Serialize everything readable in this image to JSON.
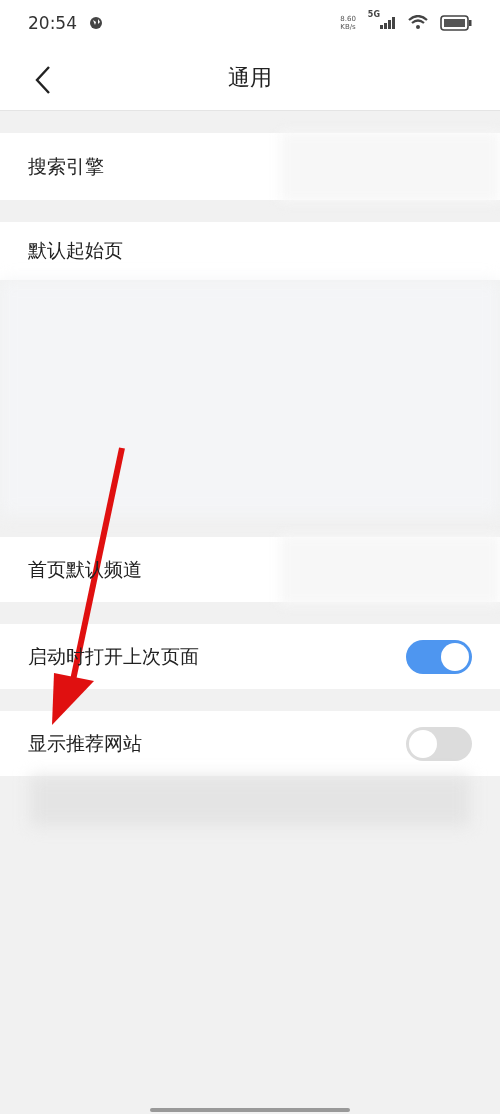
{
  "status_bar": {
    "time": "20:54",
    "speed": "8.60",
    "speed_unit": "KB/s",
    "network": "5G"
  },
  "header": {
    "title": "通用"
  },
  "sections": [
    {
      "kind": "value",
      "label": "搜索引擎"
    },
    {
      "kind": "preview",
      "label": "默认起始页"
    },
    {
      "kind": "value",
      "label": "首页默认频道"
    },
    {
      "kind": "toggle",
      "label": "启动时打开上次页面",
      "on": true
    },
    {
      "kind": "toggle",
      "label": "显示推荐网站",
      "on": false
    },
    {
      "kind": "blurred"
    }
  ]
}
